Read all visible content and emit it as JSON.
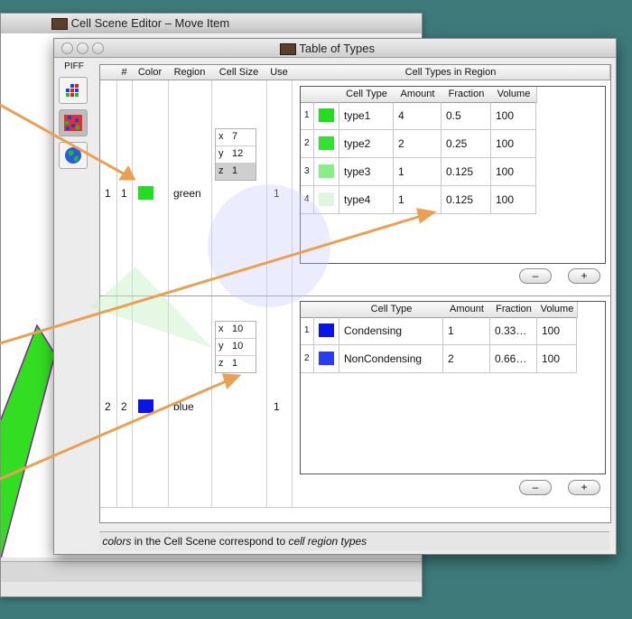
{
  "back_window": {
    "title": "Cell Scene Editor – Move Item"
  },
  "front_window": {
    "title": "Table of Types"
  },
  "piff": {
    "label": "PIFF"
  },
  "table": {
    "headers": [
      "#",
      "Color",
      "Region",
      "Cell Size",
      "Use",
      "Cell Types in Region"
    ],
    "rows": [
      {
        "num": "1",
        "index": "1",
        "region": "green",
        "region_color": "#22dd22",
        "use": "1",
        "cell_size": {
          "x": "7",
          "y": "12",
          "z": "1"
        },
        "types_headers": [
          "Cell Type",
          "Amount",
          "Fraction",
          "Volume"
        ],
        "types": [
          {
            "n": "1",
            "color": "#22dd22",
            "name": "type1",
            "amount": "4",
            "fraction": "0.5",
            "volume": "100"
          },
          {
            "n": "2",
            "color": "#33e033",
            "name": "type2",
            "amount": "2",
            "fraction": "0.25",
            "volume": "100"
          },
          {
            "n": "3",
            "color": "#88ee88",
            "name": "type3",
            "amount": "1",
            "fraction": "0.125",
            "volume": "100"
          },
          {
            "n": "4",
            "color": "#dff5df",
            "name": "type4",
            "amount": "1",
            "fraction": "0.125",
            "volume": "100"
          }
        ]
      },
      {
        "num": "2",
        "index": "2",
        "region": "blue",
        "region_color": "#0a14e6",
        "use": "1",
        "cell_size": {
          "x": "10",
          "y": "10",
          "z": "1"
        },
        "types_headers": [
          "Cell Type",
          "Amount",
          "Fraction",
          "Volume"
        ],
        "types": [
          {
            "n": "1",
            "color": "#0a14e6",
            "name": "Condensing",
            "amount": "1",
            "fraction": "0.33…",
            "volume": "100"
          },
          {
            "n": "2",
            "color": "#2a3cf0",
            "name": "NonCondensing",
            "amount": "2",
            "fraction": "0.66…",
            "volume": "100"
          }
        ]
      }
    ],
    "buttons": {
      "remove": "–",
      "add": "+"
    }
  },
  "footer": {
    "part1": "colors",
    "part2": " in the Cell Scene correspond to ",
    "part3": "cell region types"
  },
  "colors": {
    "accent_arrow": "#e8a055",
    "background": "#3f7a7a"
  }
}
